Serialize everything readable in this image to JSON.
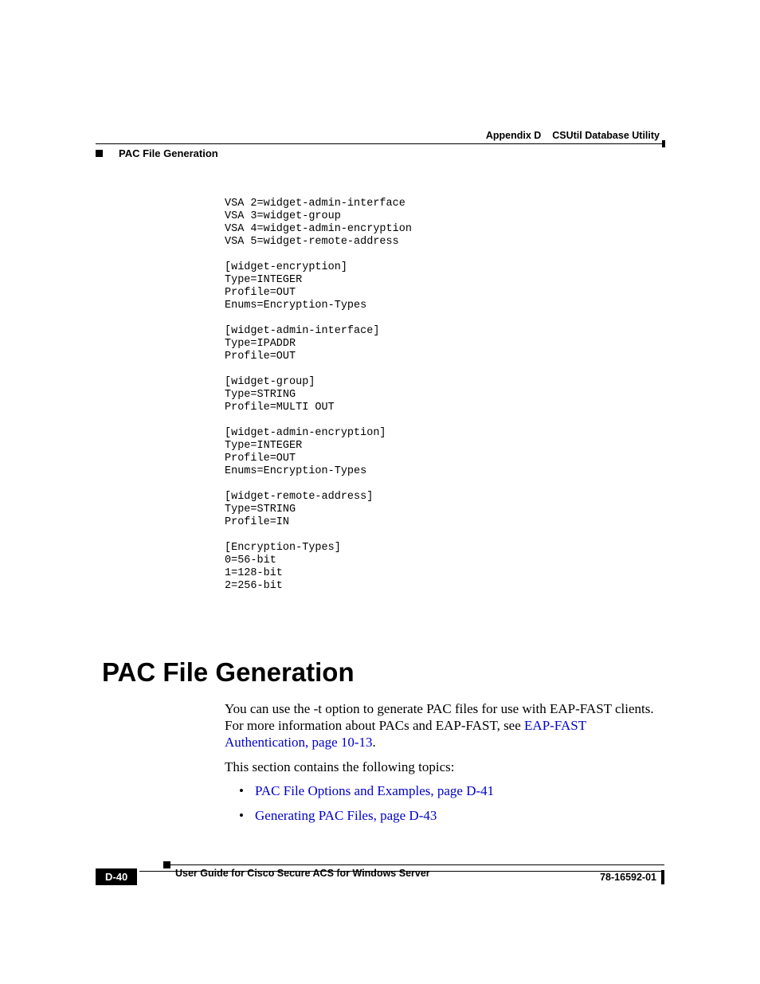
{
  "header": {
    "appendix_label": "Appendix D",
    "appendix_title": "CSUtil Database Utility",
    "section_label": "PAC File Generation"
  },
  "code": "VSA 2=widget-admin-interface\nVSA 3=widget-group\nVSA 4=widget-admin-encryption\nVSA 5=widget-remote-address\n\n[widget-encryption]\nType=INTEGER\nProfile=OUT\nEnums=Encryption-Types\n\n[widget-admin-interface]\nType=IPADDR\nProfile=OUT\n\n[widget-group]\nType=STRING\nProfile=MULTI OUT\n\n[widget-admin-encryption]\nType=INTEGER\nProfile=OUT\nEnums=Encryption-Types\n\n[widget-remote-address]\nType=STRING\nProfile=IN\n\n[Encryption-Types]\n0=56-bit\n1=128-bit\n2=256-bit",
  "heading": "PAC File Generation",
  "para1_pre": "You can use the -t option to generate PAC files for use with EAP-FAST clients. For more information about PACs and EAP-FAST, see ",
  "para1_link": "EAP-FAST Authentication, page 10-13",
  "para1_post": ".",
  "para2": "This section contains the following topics:",
  "bullets": [
    "PAC File Options and Examples, page D-41",
    "Generating PAC Files, page D-43"
  ],
  "footer": {
    "guide_title": "User Guide for Cisco Secure ACS for Windows Server",
    "page_number": "D-40",
    "doc_id": "78-16592-01"
  }
}
